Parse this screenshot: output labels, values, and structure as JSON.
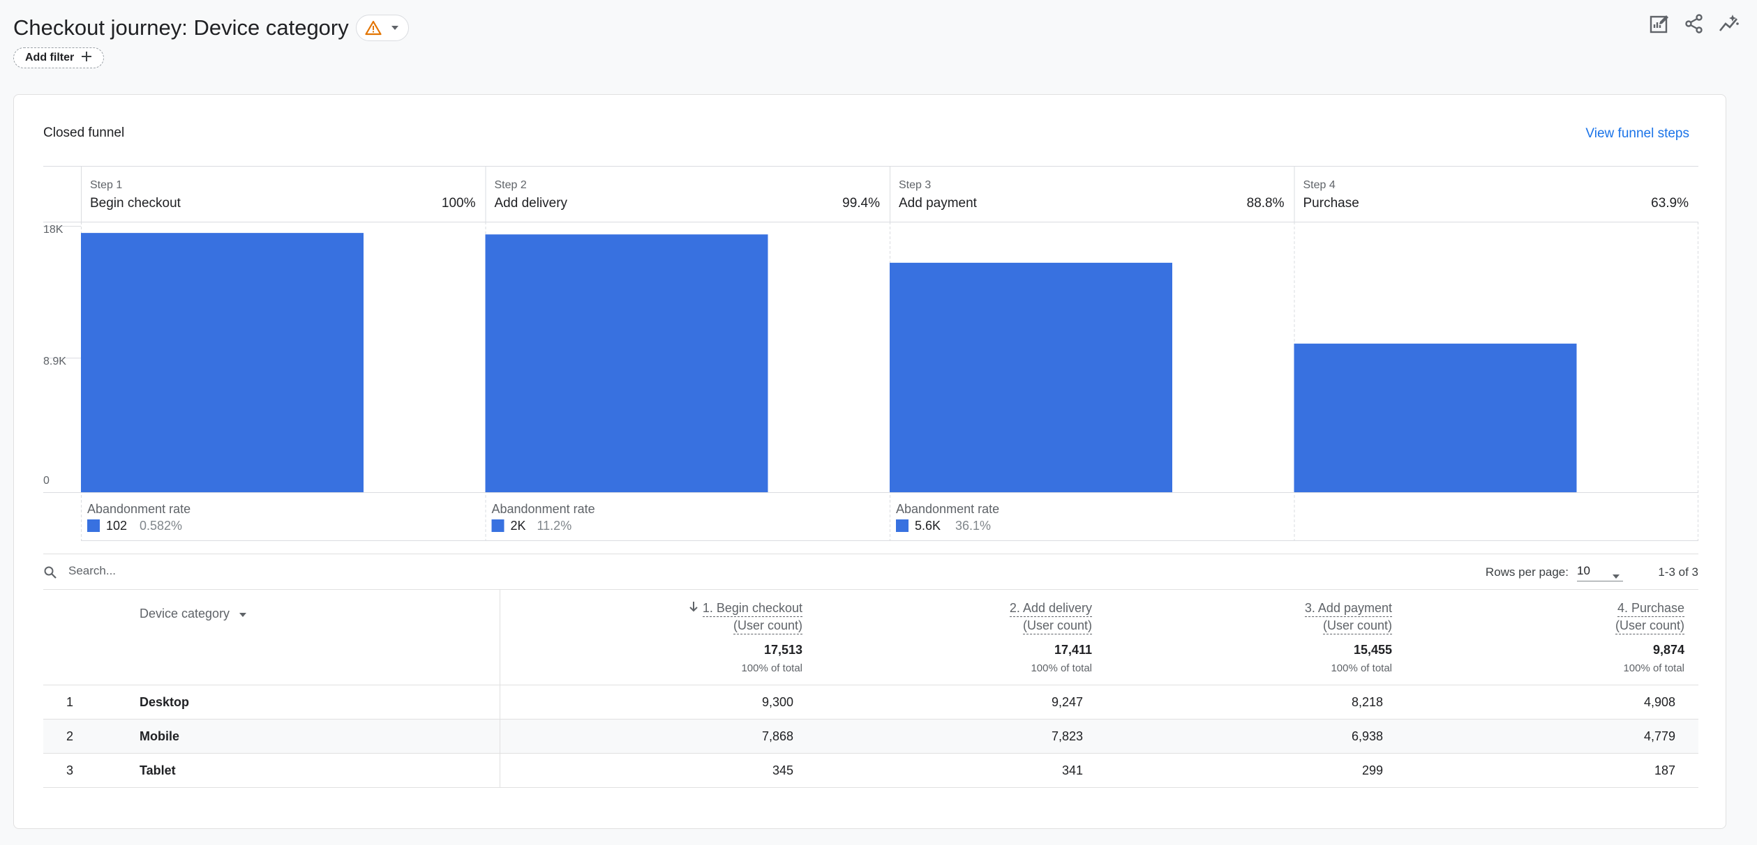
{
  "header": {
    "title": "Checkout journey: Device category",
    "add_filter_label": "Add filter",
    "warning_icon": "warning-icon",
    "toolbar_icons": [
      "edit-report-icon",
      "share-icon",
      "insights-icon"
    ]
  },
  "card": {
    "title": "Closed funnel",
    "view_link": "View funnel steps"
  },
  "colors": {
    "bar": "#3871e0",
    "accent": "#1a73e8",
    "warning": "#e37400"
  },
  "chart_data": {
    "type": "bar",
    "title": "",
    "y_ticks": [
      "18K",
      "8.9K",
      "0"
    ],
    "ylim": [
      0,
      18000
    ],
    "steps": [
      {
        "step_label": "Step 1",
        "name": "Begin checkout",
        "percent": "100%",
        "value": 17513,
        "abandonment": {
          "label": "Abandonment rate",
          "count": "102",
          "rate": "0.582%"
        }
      },
      {
        "step_label": "Step 2",
        "name": "Add delivery",
        "percent": "99.4%",
        "value": 17411,
        "abandonment": {
          "label": "Abandonment rate",
          "count": "2K",
          "rate": "11.2%"
        }
      },
      {
        "step_label": "Step 3",
        "name": "Add payment",
        "percent": "88.8%",
        "value": 15455,
        "abandonment": {
          "label": "Abandonment rate",
          "count": "5.6K",
          "rate": "36.1%"
        }
      },
      {
        "step_label": "Step 4",
        "name": "Purchase",
        "percent": "63.9%",
        "value": 9874,
        "abandonment": null
      }
    ],
    "grid": true
  },
  "table": {
    "search_placeholder": "Search...",
    "rows_per_page_label": "Rows per page:",
    "rows_per_page_value": "10",
    "pager_text": "1-3 of 3",
    "dimension_header": "Device category",
    "columns": [
      {
        "name": "1. Begin checkout",
        "unit": "(User count)",
        "sorted": true
      },
      {
        "name": "2. Add delivery",
        "unit": "(User count)",
        "sorted": false
      },
      {
        "name": "3. Add payment",
        "unit": "(User count)",
        "sorted": false
      },
      {
        "name": "4. Purchase",
        "unit": "(User count)",
        "sorted": false
      }
    ],
    "totals": [
      {
        "value": "17,513",
        "pct": "100% of total"
      },
      {
        "value": "17,411",
        "pct": "100% of total"
      },
      {
        "value": "15,455",
        "pct": "100% of total"
      },
      {
        "value": "9,874",
        "pct": "100% of total"
      }
    ],
    "rows": [
      {
        "index": "1",
        "dimension": "Desktop",
        "values": [
          "9,300",
          "9,247",
          "8,218",
          "4,908"
        ]
      },
      {
        "index": "2",
        "dimension": "Mobile",
        "values": [
          "7,868",
          "7,823",
          "6,938",
          "4,779"
        ]
      },
      {
        "index": "3",
        "dimension": "Tablet",
        "values": [
          "345",
          "341",
          "299",
          "187"
        ]
      }
    ]
  }
}
